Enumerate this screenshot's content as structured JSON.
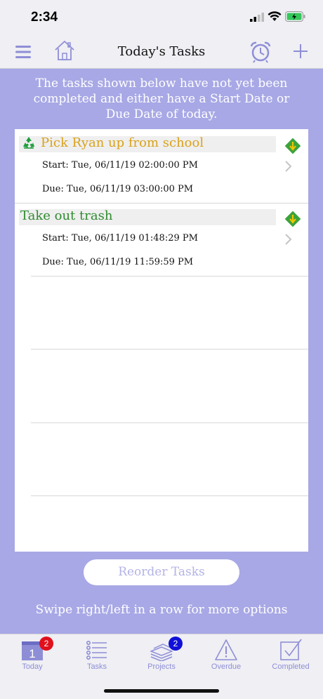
{
  "status_bar": {
    "time": "2:34"
  },
  "nav": {
    "title": "Today's Tasks",
    "icons": [
      "menu-icon",
      "home-icon",
      "alarm-clock-icon",
      "plus-icon"
    ]
  },
  "info_text": "The tasks shown below have not yet been completed and either have a Start Date or Due Date of today.",
  "tasks": [
    {
      "title": "Pick Ryan up from school",
      "title_color": "#d9a21b",
      "recurring": true,
      "start": "Start: Tue, 06/11/19 02:00:00 PM",
      "due": "Due: Tue, 06/11/19 03:00:00 PM"
    },
    {
      "title": "Take out trash",
      "title_color": "#2e8b2e",
      "recurring": false,
      "start": "Start: Tue, 06/11/19 01:48:29 PM",
      "due": "Due: Tue, 06/11/19 11:59:59 PM"
    }
  ],
  "reorder_label": "Reorder Tasks",
  "swipe_hint": "Swipe right/left in a row for more options",
  "tabs": [
    {
      "label": "Today",
      "icon": "calendar-icon",
      "badge": "2",
      "badge_color": "#e0101c",
      "active": true
    },
    {
      "label": "Tasks",
      "icon": "list-icon",
      "badge": "",
      "active": false
    },
    {
      "label": "Projects",
      "icon": "stack-icon",
      "badge": "2",
      "badge_color": "#1010d8",
      "active": false
    },
    {
      "label": "Overdue",
      "icon": "warning-icon",
      "badge": "",
      "active": false
    },
    {
      "label": "Completed",
      "icon": "checkbox-icon",
      "badge": "",
      "active": false
    }
  ],
  "colors": {
    "accent": "#8e8ed6",
    "background": "#a8a8e6",
    "priority": "#3ba33b"
  }
}
